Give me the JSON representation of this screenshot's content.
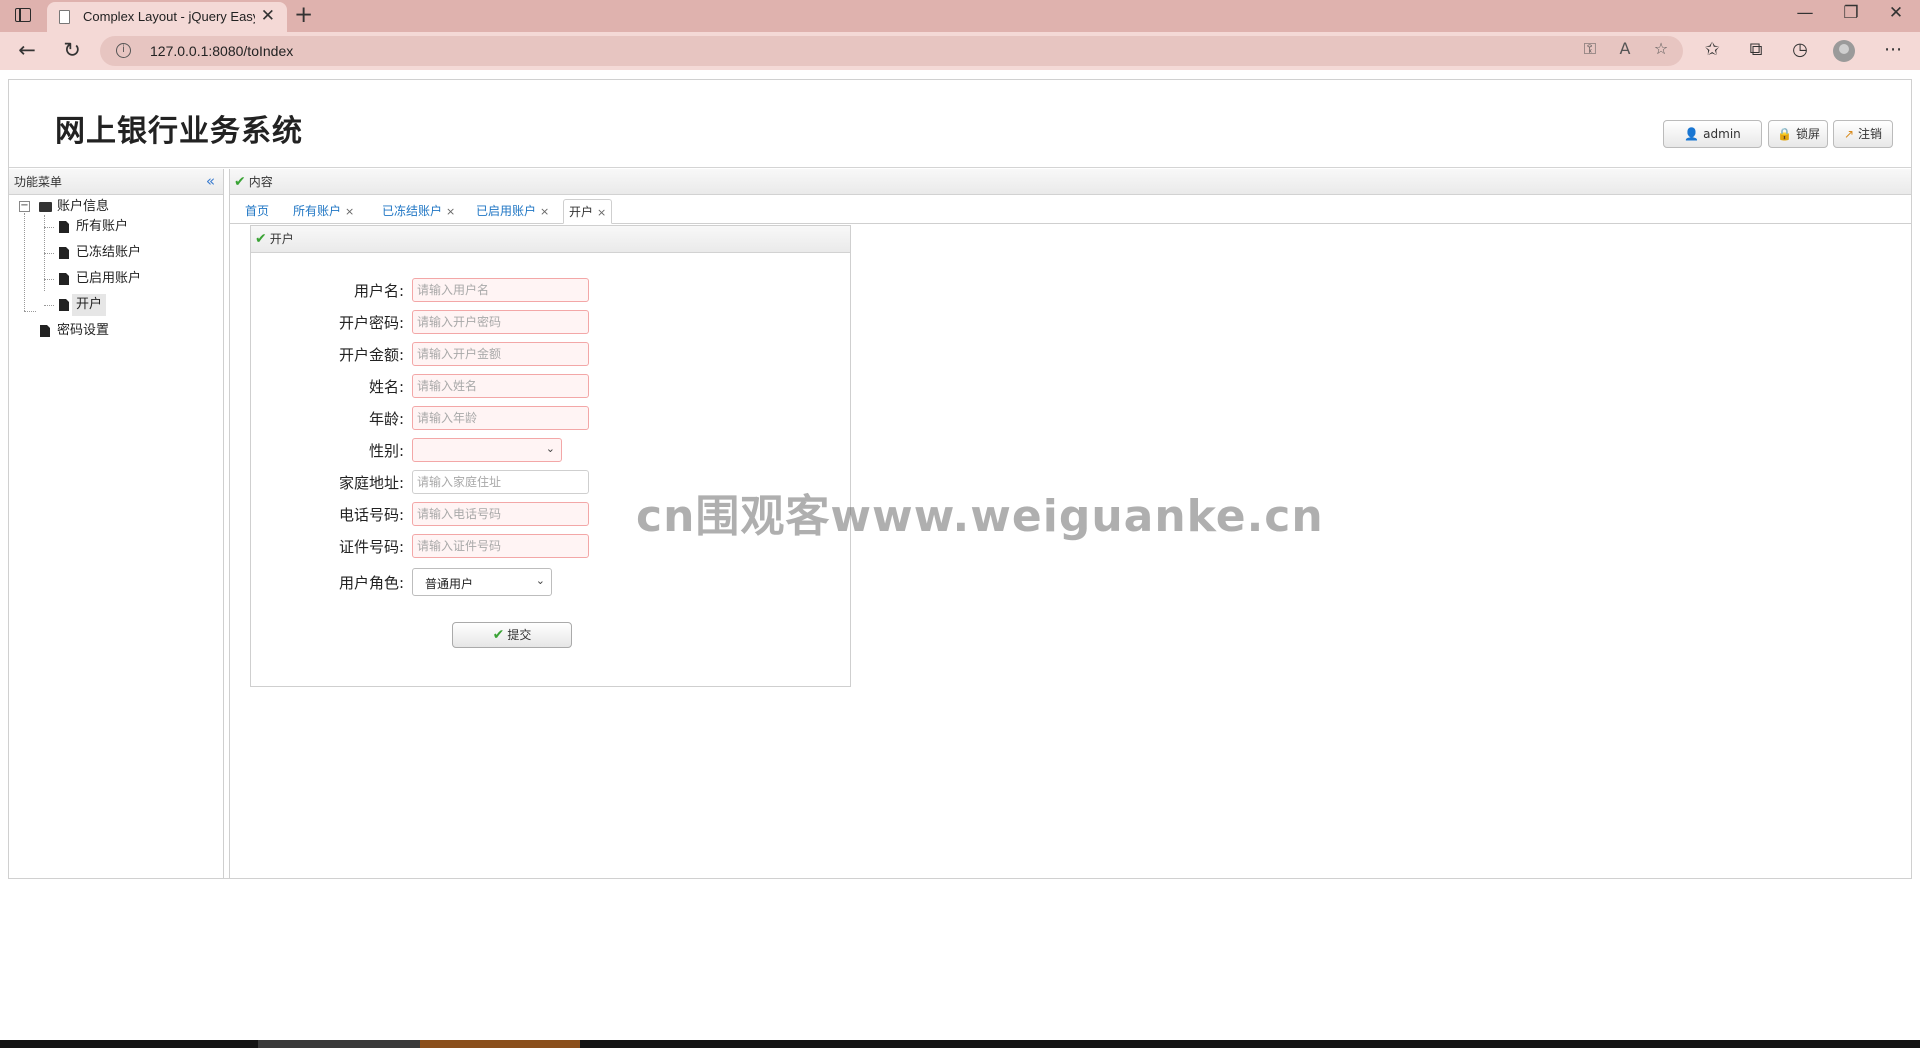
{
  "browser": {
    "tab_title": "Complex Layout - jQuery EasyUI",
    "tab_close": "✕",
    "new_tab": "+",
    "url": "127.0.0.1:8080/toIndex"
  },
  "header": {
    "title": "网上银行业务系统",
    "buttons": [
      {
        "label": "admin",
        "icon": "user-icon"
      },
      {
        "label": "锁屏",
        "icon": "lock-icon"
      },
      {
        "label": "注销",
        "icon": "logout-icon"
      }
    ]
  },
  "sidebar": {
    "title": "功能菜单",
    "collapse_glyph": "«",
    "tree": {
      "root": {
        "label": "账户信息",
        "toggle": "−"
      },
      "children": [
        {
          "label": "所有账户"
        },
        {
          "label": "已冻结账户"
        },
        {
          "label": "已启用账户"
        },
        {
          "label": "开户"
        }
      ],
      "other": {
        "label": "密码设置"
      }
    }
  },
  "content": {
    "title": "内容",
    "tabs": [
      {
        "label": "首页",
        "closable": false
      },
      {
        "label": "所有账户",
        "closable": true
      },
      {
        "label": "已冻结账户",
        "closable": true
      },
      {
        "label": "已启用账户",
        "closable": true
      },
      {
        "label": "开户",
        "closable": true
      }
    ],
    "tab_close_glyph": "×"
  },
  "form": {
    "title": "开户",
    "fields": [
      {
        "label": "用户名:",
        "placeholder": "请输入用户名"
      },
      {
        "label": "开户密码:",
        "placeholder": "请输入开户密码"
      },
      {
        "label": "开户金额:",
        "placeholder": "请输入开户金额"
      },
      {
        "label": "姓名:",
        "placeholder": "请输入姓名"
      },
      {
        "label": "年龄:",
        "placeholder": "请输入年龄"
      },
      {
        "label": "性别:",
        "value": ""
      },
      {
        "label": "家庭地址:",
        "placeholder": "请输入家庭住址"
      },
      {
        "label": "电话号码:",
        "placeholder": "请输入电话号码"
      },
      {
        "label": "证件号码:",
        "placeholder": "请输入证件号码"
      },
      {
        "label": "用户角色:",
        "value": "普通用户"
      }
    ],
    "submit_label": "提交"
  },
  "watermark": "cn围观客www.weiguanke.cn",
  "colors": {
    "browser_tabstrip": "#dfb2ae",
    "browser_toolbar": "#f4d9d6",
    "link_blue": "#1f76c4",
    "invalid_border": "#f3a7a7",
    "check_green": "#3aa335"
  }
}
